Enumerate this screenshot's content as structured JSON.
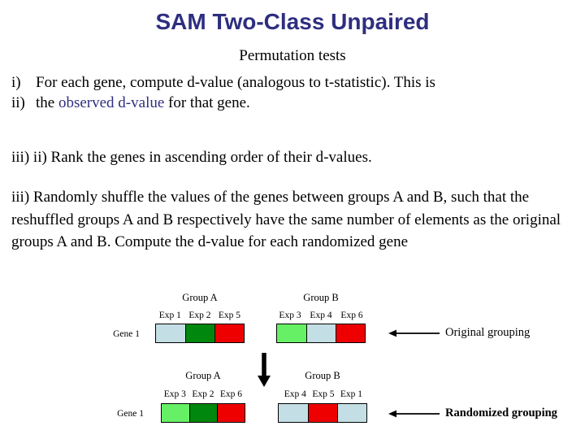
{
  "slide": {
    "title": "SAM Two-Class Unpaired",
    "subtitle": "Permutation tests",
    "accent_color": "#2e2e80"
  },
  "steps": {
    "item_i": {
      "marker": "i)",
      "text": "For each gene, compute d-value (analogous to t-statistic). This is"
    },
    "item_ii": {
      "marker": "ii)",
      "text_before": "the ",
      "highlight": "observed d-value",
      "text_after": " for that gene."
    },
    "item_iii_rank": "iii) ii) Rank the genes in ascending order of their d-values.",
    "item_iii_shuffle": "iii) Randomly shuffle the values of the genes between groups A and B, such that the reshuffled groups A and B respectively have the same number of elements as the original groups A and B. Compute the d-value for each randomized gene"
  },
  "diagram": {
    "colors": {
      "light_blue": "#c3dee4",
      "dark_green": "#00870d",
      "red": "#ee0000",
      "light_green": "#66f066"
    },
    "rows": [
      {
        "name": "original",
        "gene_label": "Gene 1",
        "annotation": "Original grouping",
        "annotation_bold": false,
        "groups": [
          {
            "label": "Group A",
            "experiments": [
              "Exp 1",
              "Exp 2",
              "Exp 5"
            ],
            "cell_colors": [
              "#c3dee4",
              "#00870d",
              "#ee0000"
            ]
          },
          {
            "label": "Group B",
            "experiments": [
              "Exp 3",
              "Exp 4",
              "Exp 6"
            ],
            "cell_colors": [
              "#66f066",
              "#c3dee4",
              "#ee0000"
            ]
          }
        ]
      },
      {
        "name": "randomized",
        "gene_label": "Gene 1",
        "annotation": "Randomized grouping",
        "annotation_bold": true,
        "groups": [
          {
            "label": "Group A",
            "experiments": [
              "Exp 3",
              "Exp 2",
              "Exp 6"
            ],
            "cell_colors": [
              "#66f066",
              "#00870d",
              "#ee0000"
            ]
          },
          {
            "label": "Group B",
            "experiments": [
              "Exp 4",
              "Exp 5",
              "Exp 1"
            ],
            "cell_colors": [
              "#c3dee4",
              "#ee0000",
              "#c3dee4"
            ]
          }
        ]
      }
    ]
  }
}
